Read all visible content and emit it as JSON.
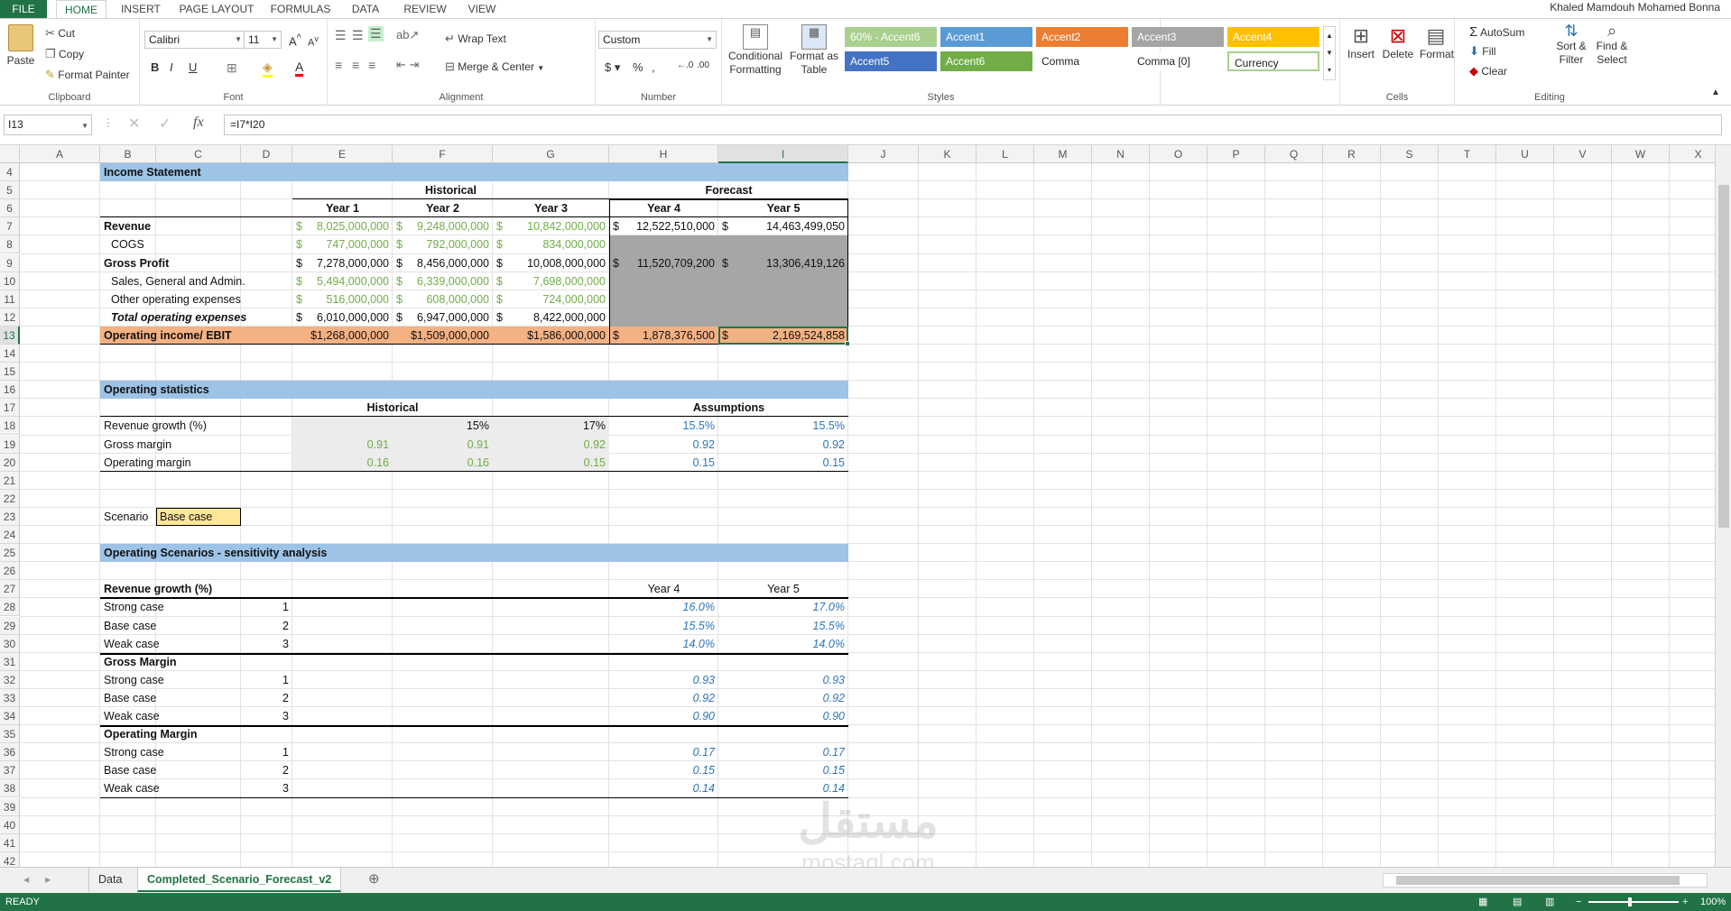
{
  "menu": {
    "file": "FILE",
    "tabs": [
      "HOME",
      "INSERT",
      "PAGE LAYOUT",
      "FORMULAS",
      "DATA",
      "REVIEW",
      "VIEW"
    ],
    "user": "Khaled  Mamdouh Mohamed Bonna"
  },
  "ribbon": {
    "clipboard": {
      "paste": "Paste",
      "cut": "Cut",
      "copy": "Copy",
      "format_painter": "Format Painter",
      "label": "Clipboard"
    },
    "font": {
      "name": "Calibri",
      "size": "11",
      "label": "Font"
    },
    "alignment": {
      "wrap": "Wrap Text",
      "merge": "Merge & Center",
      "label": "Alignment"
    },
    "number": {
      "format": "Custom",
      "label": "Number"
    },
    "styles": {
      "cond": "Conditional Formatting",
      "table": "Format as Table",
      "label": "Styles",
      "gallery": [
        "60% - Accent6",
        "Accent1",
        "Accent2",
        "Accent3",
        "Accent4",
        "Accent5",
        "Accent6",
        "Comma",
        "Comma [0]",
        "Currency"
      ]
    },
    "cells": {
      "insert": "Insert",
      "delete": "Delete",
      "format": "Format",
      "label": "Cells"
    },
    "editing": {
      "autosum": "AutoSum",
      "fill": "Fill",
      "clear": "Clear",
      "sort": "Sort & Filter",
      "find": "Find & Select",
      "label": "Editing"
    }
  },
  "formula_bar": {
    "name_box": "I13",
    "formula": "=I7*I20"
  },
  "columns": [
    "A",
    "B",
    "C",
    "D",
    "E",
    "F",
    "G",
    "H",
    "I",
    "J",
    "K",
    "L",
    "M",
    "N",
    "O",
    "P",
    "Q",
    "R",
    "S",
    "T",
    "U",
    "V",
    "W",
    "X"
  ],
  "selected_column": "I",
  "rows": [
    "4",
    "5",
    "6",
    "7",
    "8",
    "9",
    "10",
    "11",
    "12",
    "13",
    "14",
    "15",
    "16",
    "17",
    "18",
    "19",
    "20",
    "21",
    "22",
    "23",
    "24",
    "25",
    "26",
    "27",
    "28",
    "29",
    "30",
    "31",
    "32",
    "33",
    "34",
    "35",
    "36",
    "37",
    "38",
    "39",
    "40",
    "41",
    "42"
  ],
  "selected_row": "13",
  "sheet": {
    "income_title": "Income Statement",
    "historical": "Historical",
    "forecast": "Forecast",
    "years": [
      "Year 1",
      "Year 2",
      "Year 3",
      "Year 4",
      "Year 5"
    ],
    "income_rows": [
      {
        "label": "Revenue",
        "vals": [
          "8,025,000,000",
          "9,248,000,000",
          "10,842,000,000",
          "12,522,510,000",
          "14,463,499,050"
        ]
      },
      {
        "label": "COGS",
        "vals": [
          "747,000,000",
          "792,000,000",
          "834,000,000",
          "",
          ""
        ]
      },
      {
        "label": "Gross Profit",
        "vals": [
          "7,278,000,000",
          "8,456,000,000",
          "10,008,000,000",
          "11,520,709,200",
          "13,306,419,126"
        ]
      },
      {
        "label": "Sales, General and Admin.",
        "vals": [
          "5,494,000,000",
          "6,339,000,000",
          "7,698,000,000",
          "",
          ""
        ]
      },
      {
        "label": "Other operating expenses",
        "vals": [
          "516,000,000",
          "608,000,000",
          "724,000,000",
          "",
          ""
        ]
      },
      {
        "label": "Total operating expenses",
        "vals": [
          "6,010,000,000",
          "6,947,000,000",
          "8,422,000,000",
          "",
          ""
        ]
      }
    ],
    "dollar": "$",
    "ebit": {
      "label": "Operating income/ EBIT",
      "vals": [
        "$1,268,000,000",
        "$1,509,000,000",
        "$1,586,000,000",
        "1,878,376,500",
        "2,169,524,858"
      ]
    },
    "opstats_title": "Operating statistics",
    "assumptions": "Assumptions",
    "opstats_rows": [
      {
        "label": "Revenue growth (%)",
        "vals": [
          "",
          "15%",
          "17%",
          "15.5%",
          "15.5%"
        ]
      },
      {
        "label": "Gross margin",
        "vals": [
          "0.91",
          "0.91",
          "0.92",
          "0.92",
          "0.92"
        ]
      },
      {
        "label": "Operating margin",
        "vals": [
          "0.16",
          "0.16",
          "0.15",
          "0.15",
          "0.15"
        ]
      }
    ],
    "scenario_label": "Scenario",
    "scenario_value": "Base case",
    "scen_title": "Operating Scenarios - sensitivity analysis",
    "year4": "Year 4",
    "year5": "Year 5",
    "scen_blocks": [
      {
        "title": "Revenue growth (%)",
        "rows": [
          {
            "label": "Strong case",
            "n": "1",
            "y4": "16.0%",
            "y5": "17.0%"
          },
          {
            "label": "Base case",
            "n": "2",
            "y4": "15.5%",
            "y5": "15.5%"
          },
          {
            "label": "Weak case",
            "n": "3",
            "y4": "14.0%",
            "y5": "14.0%"
          }
        ]
      },
      {
        "title": "Gross Margin",
        "rows": [
          {
            "label": "Strong case",
            "n": "1",
            "y4": "0.93",
            "y5": "0.93"
          },
          {
            "label": "Base case",
            "n": "2",
            "y4": "0.92",
            "y5": "0.92"
          },
          {
            "label": "Weak case",
            "n": "3",
            "y4": "0.90",
            "y5": "0.90"
          }
        ]
      },
      {
        "title": "Operating Margin",
        "rows": [
          {
            "label": "Strong case",
            "n": "1",
            "y4": "0.17",
            "y5": "0.17"
          },
          {
            "label": "Base case",
            "n": "2",
            "y4": "0.15",
            "y5": "0.15"
          },
          {
            "label": "Weak case",
            "n": "3",
            "y4": "0.14",
            "y5": "0.14"
          }
        ]
      }
    ]
  },
  "watermark": "mostaql.com",
  "sheet_tabs": [
    "Data",
    "Completed_Scenario_Forecast_v2"
  ],
  "status": {
    "ready": "READY",
    "zoom": "100%"
  },
  "colors": {
    "excel_green": "#217346",
    "section_blue": "#9dc3e6",
    "ebit_orange": "#f4b183",
    "scenario_yellow": "#ffe699",
    "gray_fill": "#a6a6a6"
  }
}
